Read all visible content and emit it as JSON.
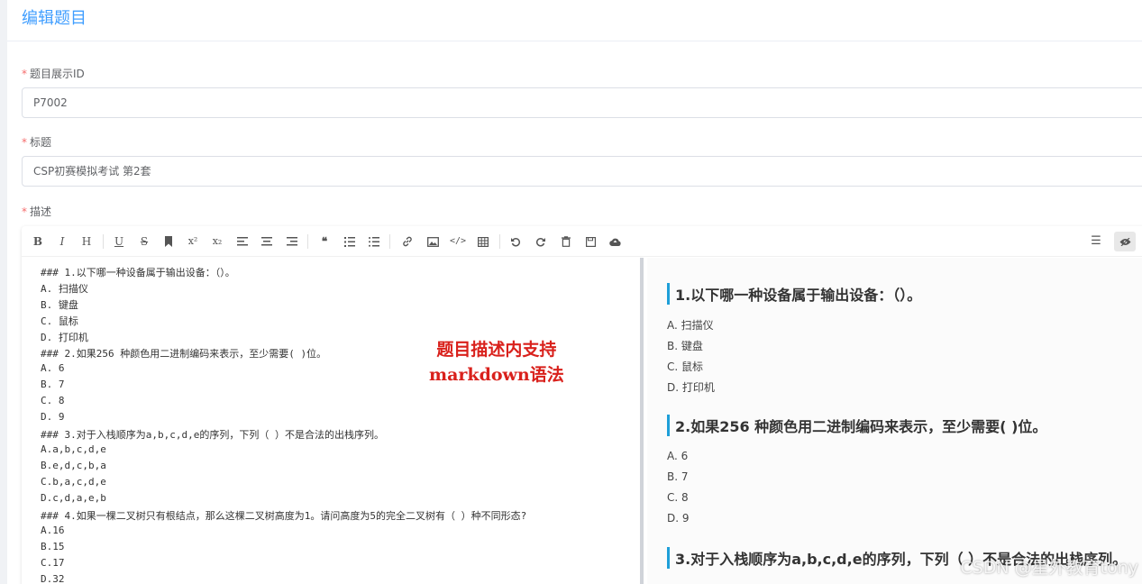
{
  "page": {
    "title": "编辑题目"
  },
  "form": {
    "display_id": {
      "label": "题目展示ID",
      "required_mark": "*",
      "value": "P7002"
    },
    "title": {
      "label": "标题",
      "required_mark": "*",
      "value": "CSP初赛模拟考试 第2套"
    },
    "description": {
      "label": "描述",
      "required_mark": "*"
    }
  },
  "toolbar": {
    "buttons": [
      "B",
      "I",
      "H",
      "U",
      "S",
      "bookmark",
      "x²",
      "x₂",
      "align-left",
      "align-center",
      "align-right",
      "quote",
      "ordered-list",
      "unordered-list",
      "link",
      "image",
      "code",
      "table",
      "undo",
      "redo",
      "trash",
      "save",
      "upload"
    ],
    "glyphs": {
      "bold": "B",
      "italic": "I",
      "header": "H",
      "underline": "U",
      "strike": "S",
      "sup": "x²",
      "sub": "x₂",
      "quote": "❝"
    },
    "right": {
      "menu": "☰",
      "preview": "👁"
    }
  },
  "editor": {
    "lines": [
      "### 1.以下哪一种设备属于输出设备：（）。",
      "A. 扫描仪",
      "B. 键盘",
      "C. 鼠标",
      "D. 打印机",
      "### 2.如果256 种颜色用二进制编码来表示，至少需要( )位。",
      "A. 6",
      "B. 7",
      "C. 8",
      "D. 9",
      "### 3.对于入栈顺序为a,b,c,d,e的序列，下列（ ）不是合法的出栈序列。",
      "A.a,b,c,d,e",
      "B.e,d,c,b,a",
      "C.b,a,c,d,e",
      "D.c,d,a,e,b",
      "### 4.如果一棵二叉树只有根结点，那么这棵二叉树高度为1。请问高度为5的完全二叉树有（ ）种不同形态?",
      "A.16",
      "B.15",
      "C.17",
      "D.32"
    ],
    "annotation": {
      "line1": "题目描述内支持",
      "line2": "markdown语法"
    }
  },
  "preview": {
    "q1": {
      "heading": "1.以下哪一种设备属于输出设备：（）。",
      "options": [
        "A. 扫描仪",
        "B. 键盘",
        "C. 鼠标",
        "D. 打印机"
      ]
    },
    "q2": {
      "heading": "2.如果256 种颜色用二进制编码来表示，至少需要( )位。",
      "options": [
        "A. 6",
        "B. 7",
        "C. 8",
        "D. 9"
      ]
    },
    "q3": {
      "heading": "3.对于入栈顺序为a,b,c,d,e的序列，下列（ ）不是合法的出栈序列。"
    }
  },
  "watermark": "CSDN @星外教育tony",
  "colors": {
    "accent": "#409eff",
    "required": "#f56c6c",
    "annotation": "#d9211c",
    "preview_bar": "#1e9fd8"
  }
}
